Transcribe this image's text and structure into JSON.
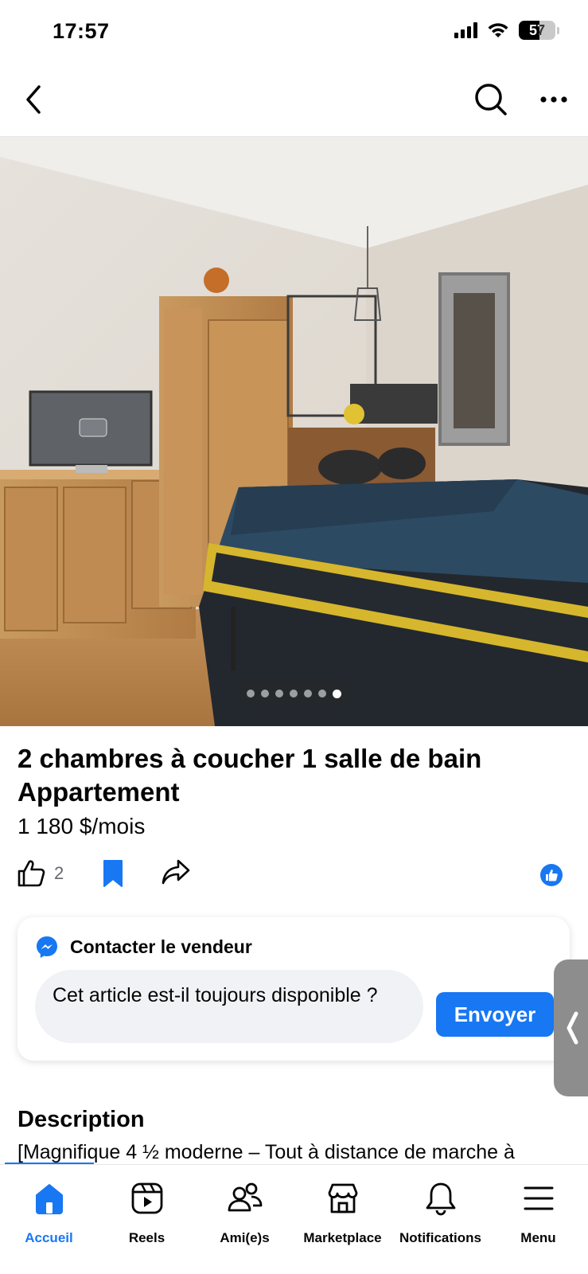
{
  "status_bar": {
    "time": "17:57",
    "battery": "57"
  },
  "top_nav": {
    "back_icon": "chevron-left-icon",
    "search_icon": "search-icon",
    "more_icon": "ellipsis-icon"
  },
  "gallery": {
    "photo_count": 7,
    "active_index": 6
  },
  "listing": {
    "title": "2 chambres à coucher 1 salle de bain Appartement",
    "price": "1 180 $/mois",
    "like_count": "2"
  },
  "contact": {
    "heading": "Contacter le vendeur",
    "message": "Cet article est-il toujours disponible ?",
    "send_label": "Envoyer"
  },
  "description": {
    "heading": "Description",
    "text": "[Magnifique 4 ½ moderne – Tout à distance de marche à"
  },
  "tabs": [
    {
      "label": "Accueil",
      "icon": "home-icon",
      "active": true
    },
    {
      "label": "Reels",
      "icon": "reels-icon",
      "active": false
    },
    {
      "label": "Ami(e)s",
      "icon": "friends-icon",
      "active": false
    },
    {
      "label": "Marketplace",
      "icon": "marketplace-icon",
      "active": false
    },
    {
      "label": "Notifications",
      "icon": "bell-icon",
      "active": false
    },
    {
      "label": "Menu",
      "icon": "menu-icon",
      "active": false
    }
  ],
  "colors": {
    "accent": "#1877f2",
    "text": "#050505",
    "secondary_text": "#65676b",
    "input_bg": "#f0f2f5"
  }
}
